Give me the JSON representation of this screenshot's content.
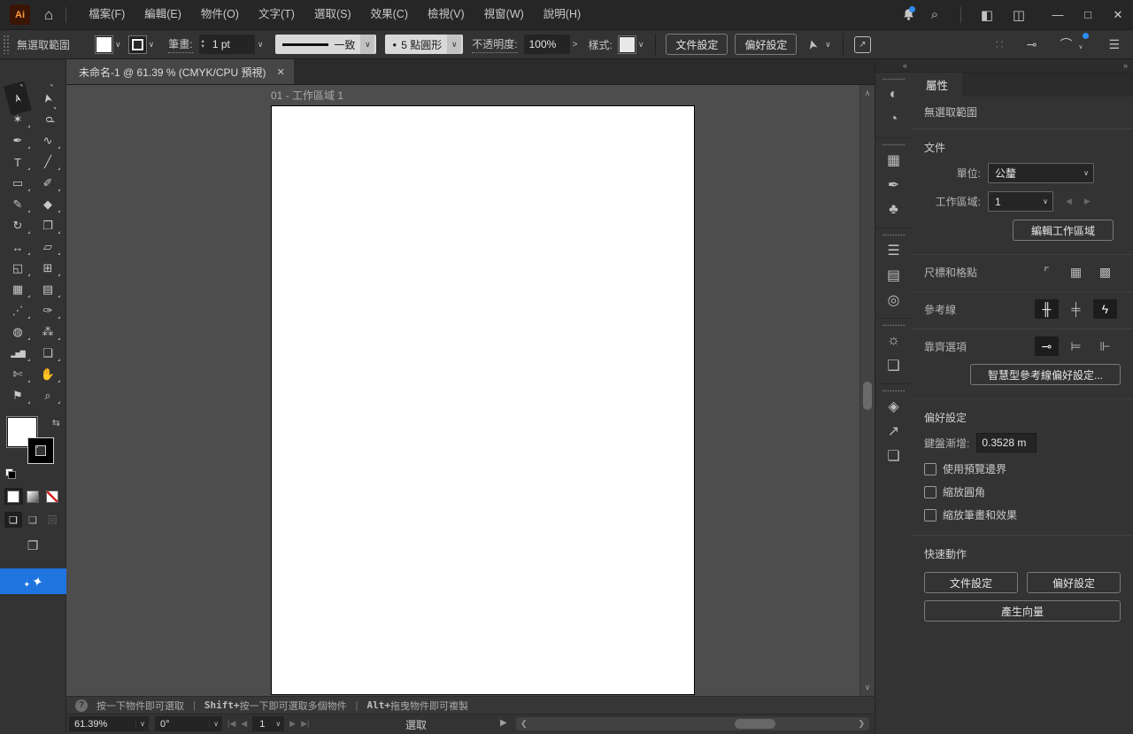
{
  "colors": {
    "accent": "#1f74e0",
    "notification_dot": "#2f8cf0",
    "artboard": "#ffffff",
    "pasteboard": "#4d4d4d"
  },
  "titlebar": {
    "app_icon_text": "Ai",
    "menus": [
      {
        "label": "檔案(F)"
      },
      {
        "label": "編輯(E)"
      },
      {
        "label": "物件(O)"
      },
      {
        "label": "文字(T)"
      },
      {
        "label": "選取(S)"
      },
      {
        "label": "效果(C)"
      },
      {
        "label": "檢視(V)"
      },
      {
        "label": "視窗(W)"
      },
      {
        "label": "說明(H)"
      }
    ],
    "window_controls": {
      "minimize": "—",
      "maximize": "□",
      "close": "✕"
    }
  },
  "icons": {
    "home": "⌂",
    "search": "⌕",
    "workspace_switcher": "◧",
    "panel_layout": "◫",
    "bell_dot": "",
    "chevron_down": "∨",
    "chevron_up": "∧",
    "chevron_right": "❯",
    "chevron_left": "❮",
    "arrow_right": ">",
    "menu": "☰",
    "align_dim": "∷",
    "snap_guide": "⊸",
    "snap_options": "⌒",
    "share": "↗",
    "pointer_options": "➤",
    "collapse_left": "«",
    "collapse_right": "»",
    "swap": "⇆",
    "ellipsis": "•••",
    "screen_mode": "❐",
    "sparkle_large": "✦",
    "sparkle_small": "✦",
    "stepper_up": "▴",
    "stepper_down": "▾",
    "nav_first": "|◀",
    "nav_prev": "◀",
    "nav_next": "▶",
    "nav_last": "▶|",
    "play": "▶",
    "help": "?"
  },
  "optionsbar": {
    "no_selection": "無選取範圍",
    "stroke_label": "筆畫:",
    "stroke_value": "1 pt",
    "stroke_profile": "一致",
    "brush_dot": "●",
    "brush_value": "5 點圓形",
    "opacity_label": "不透明度:",
    "opacity_value": "100%",
    "style_label": "樣式:",
    "doc_setup_button": "文件設定",
    "preferences_button": "偏好設定"
  },
  "tabbar": {
    "title": "未命名-1 @ 61.39 % (CMYK/CPU 預視)",
    "close": "✕"
  },
  "canvas": {
    "artboard_label": "01 - 工作區域 1"
  },
  "tools": [
    {
      "name": "selection",
      "glyph": "➢"
    },
    {
      "name": "direct-selection",
      "glyph": "➤"
    },
    {
      "name": "magic-wand",
      "glyph": "✶"
    },
    {
      "name": "lasso",
      "glyph": "ρ"
    },
    {
      "name": "pen",
      "glyph": "✒"
    },
    {
      "name": "curvature",
      "glyph": "∿"
    },
    {
      "name": "type",
      "glyph": "T"
    },
    {
      "name": "line-segment",
      "glyph": "╱"
    },
    {
      "name": "rectangle",
      "glyph": "▭"
    },
    {
      "name": "paintbrush",
      "glyph": "✐"
    },
    {
      "name": "shaper",
      "glyph": "✎"
    },
    {
      "name": "eraser",
      "glyph": "◆"
    },
    {
      "name": "rotate",
      "glyph": "↻"
    },
    {
      "name": "scale",
      "glyph": "❐"
    },
    {
      "name": "width",
      "glyph": "↔"
    },
    {
      "name": "free-transform",
      "glyph": "▱"
    },
    {
      "name": "shape-builder",
      "glyph": "◱"
    },
    {
      "name": "perspective-grid",
      "glyph": "⊞"
    },
    {
      "name": "mesh",
      "glyph": "▦"
    },
    {
      "name": "gradient",
      "glyph": "▤"
    },
    {
      "name": "blend",
      "glyph": "⋰"
    },
    {
      "name": "eyedropper",
      "glyph": "✑"
    },
    {
      "name": "symbols",
      "glyph": "◍"
    },
    {
      "name": "symbol-sprayer",
      "glyph": "⁂"
    },
    {
      "name": "column-graph",
      "glyph": "▂▅▇"
    },
    {
      "name": "artboard",
      "glyph": "❏"
    },
    {
      "name": "slice",
      "glyph": "✄"
    },
    {
      "name": "hand",
      "glyph": "✋"
    },
    {
      "name": "print-tiling",
      "glyph": "⚑"
    },
    {
      "name": "zoom",
      "glyph": "⌕"
    }
  ],
  "drawmodes": [
    {
      "glyph": "❏"
    },
    {
      "glyph": "❑"
    },
    {
      "glyph": "回"
    }
  ],
  "dock": [
    {
      "name": "color",
      "glyph": "◐"
    },
    {
      "name": "color-guide",
      "glyph": "◔"
    },
    {
      "name": "swatches",
      "glyph": "▦"
    },
    {
      "name": "brushes",
      "glyph": "✒"
    },
    {
      "name": "symbols",
      "glyph": "♣"
    },
    {
      "name": "stroke",
      "glyph": "☰"
    },
    {
      "name": "gradient",
      "glyph": "▤"
    },
    {
      "name": "transparency",
      "glyph": "◎"
    },
    {
      "name": "appearance",
      "glyph": "☼"
    },
    {
      "name": "graphic-styles",
      "glyph": "❑"
    },
    {
      "name": "layers",
      "glyph": "◈"
    },
    {
      "name": "asset-export",
      "glyph": "↗"
    },
    {
      "name": "artboards",
      "glyph": "❏"
    }
  ],
  "properties": {
    "tab": "屬性",
    "no_selection": "無選取範圍",
    "document": {
      "title": "文件",
      "unit_label": "單位:",
      "unit_value": "公釐",
      "artboard_label": "工作區域:",
      "artboard_value": "1",
      "edit_button": "編輯工作區域"
    },
    "rulers": {
      "title": "尺標和格點",
      "icons": [
        {
          "glyph": "⌜"
        },
        {
          "glyph": "▦"
        },
        {
          "glyph": "▩"
        }
      ]
    },
    "guides": {
      "title": "參考線",
      "icons": [
        {
          "glyph": "╫"
        },
        {
          "glyph": "╪"
        },
        {
          "glyph": "ϟ"
        }
      ]
    },
    "snap": {
      "title": "靠齊選項",
      "icons": [
        {
          "glyph": "⊸"
        },
        {
          "glyph": "⊨"
        },
        {
          "glyph": "⊩"
        }
      ],
      "smart_button": "智慧型參考線偏好設定..."
    },
    "prefs": {
      "title": "偏好設定",
      "kbd_label": "鍵盤漸增:",
      "kbd_value": "0.3528 m",
      "checkbox1": "使用預覽邊界",
      "checkbox2": "縮放圓角",
      "checkbox3": "縮放筆畫和效果"
    },
    "quick": {
      "title": "快速動作",
      "doc_setup": "文件設定",
      "preferences": "偏好設定",
      "generate": "產生向量"
    }
  },
  "hints": {
    "separator": "|",
    "items": [
      {
        "prefix": "",
        "text": "按一下物件即可選取"
      },
      {
        "prefix": "Shift+",
        "text": " 按一下即可選取多個物件"
      },
      {
        "prefix": "Alt+",
        "text": " 拖曳物件即可複製"
      }
    ]
  },
  "statusbar": {
    "zoom": "61.39%",
    "rotation": "0°",
    "artboard_number": "1",
    "tool_name": "選取"
  }
}
